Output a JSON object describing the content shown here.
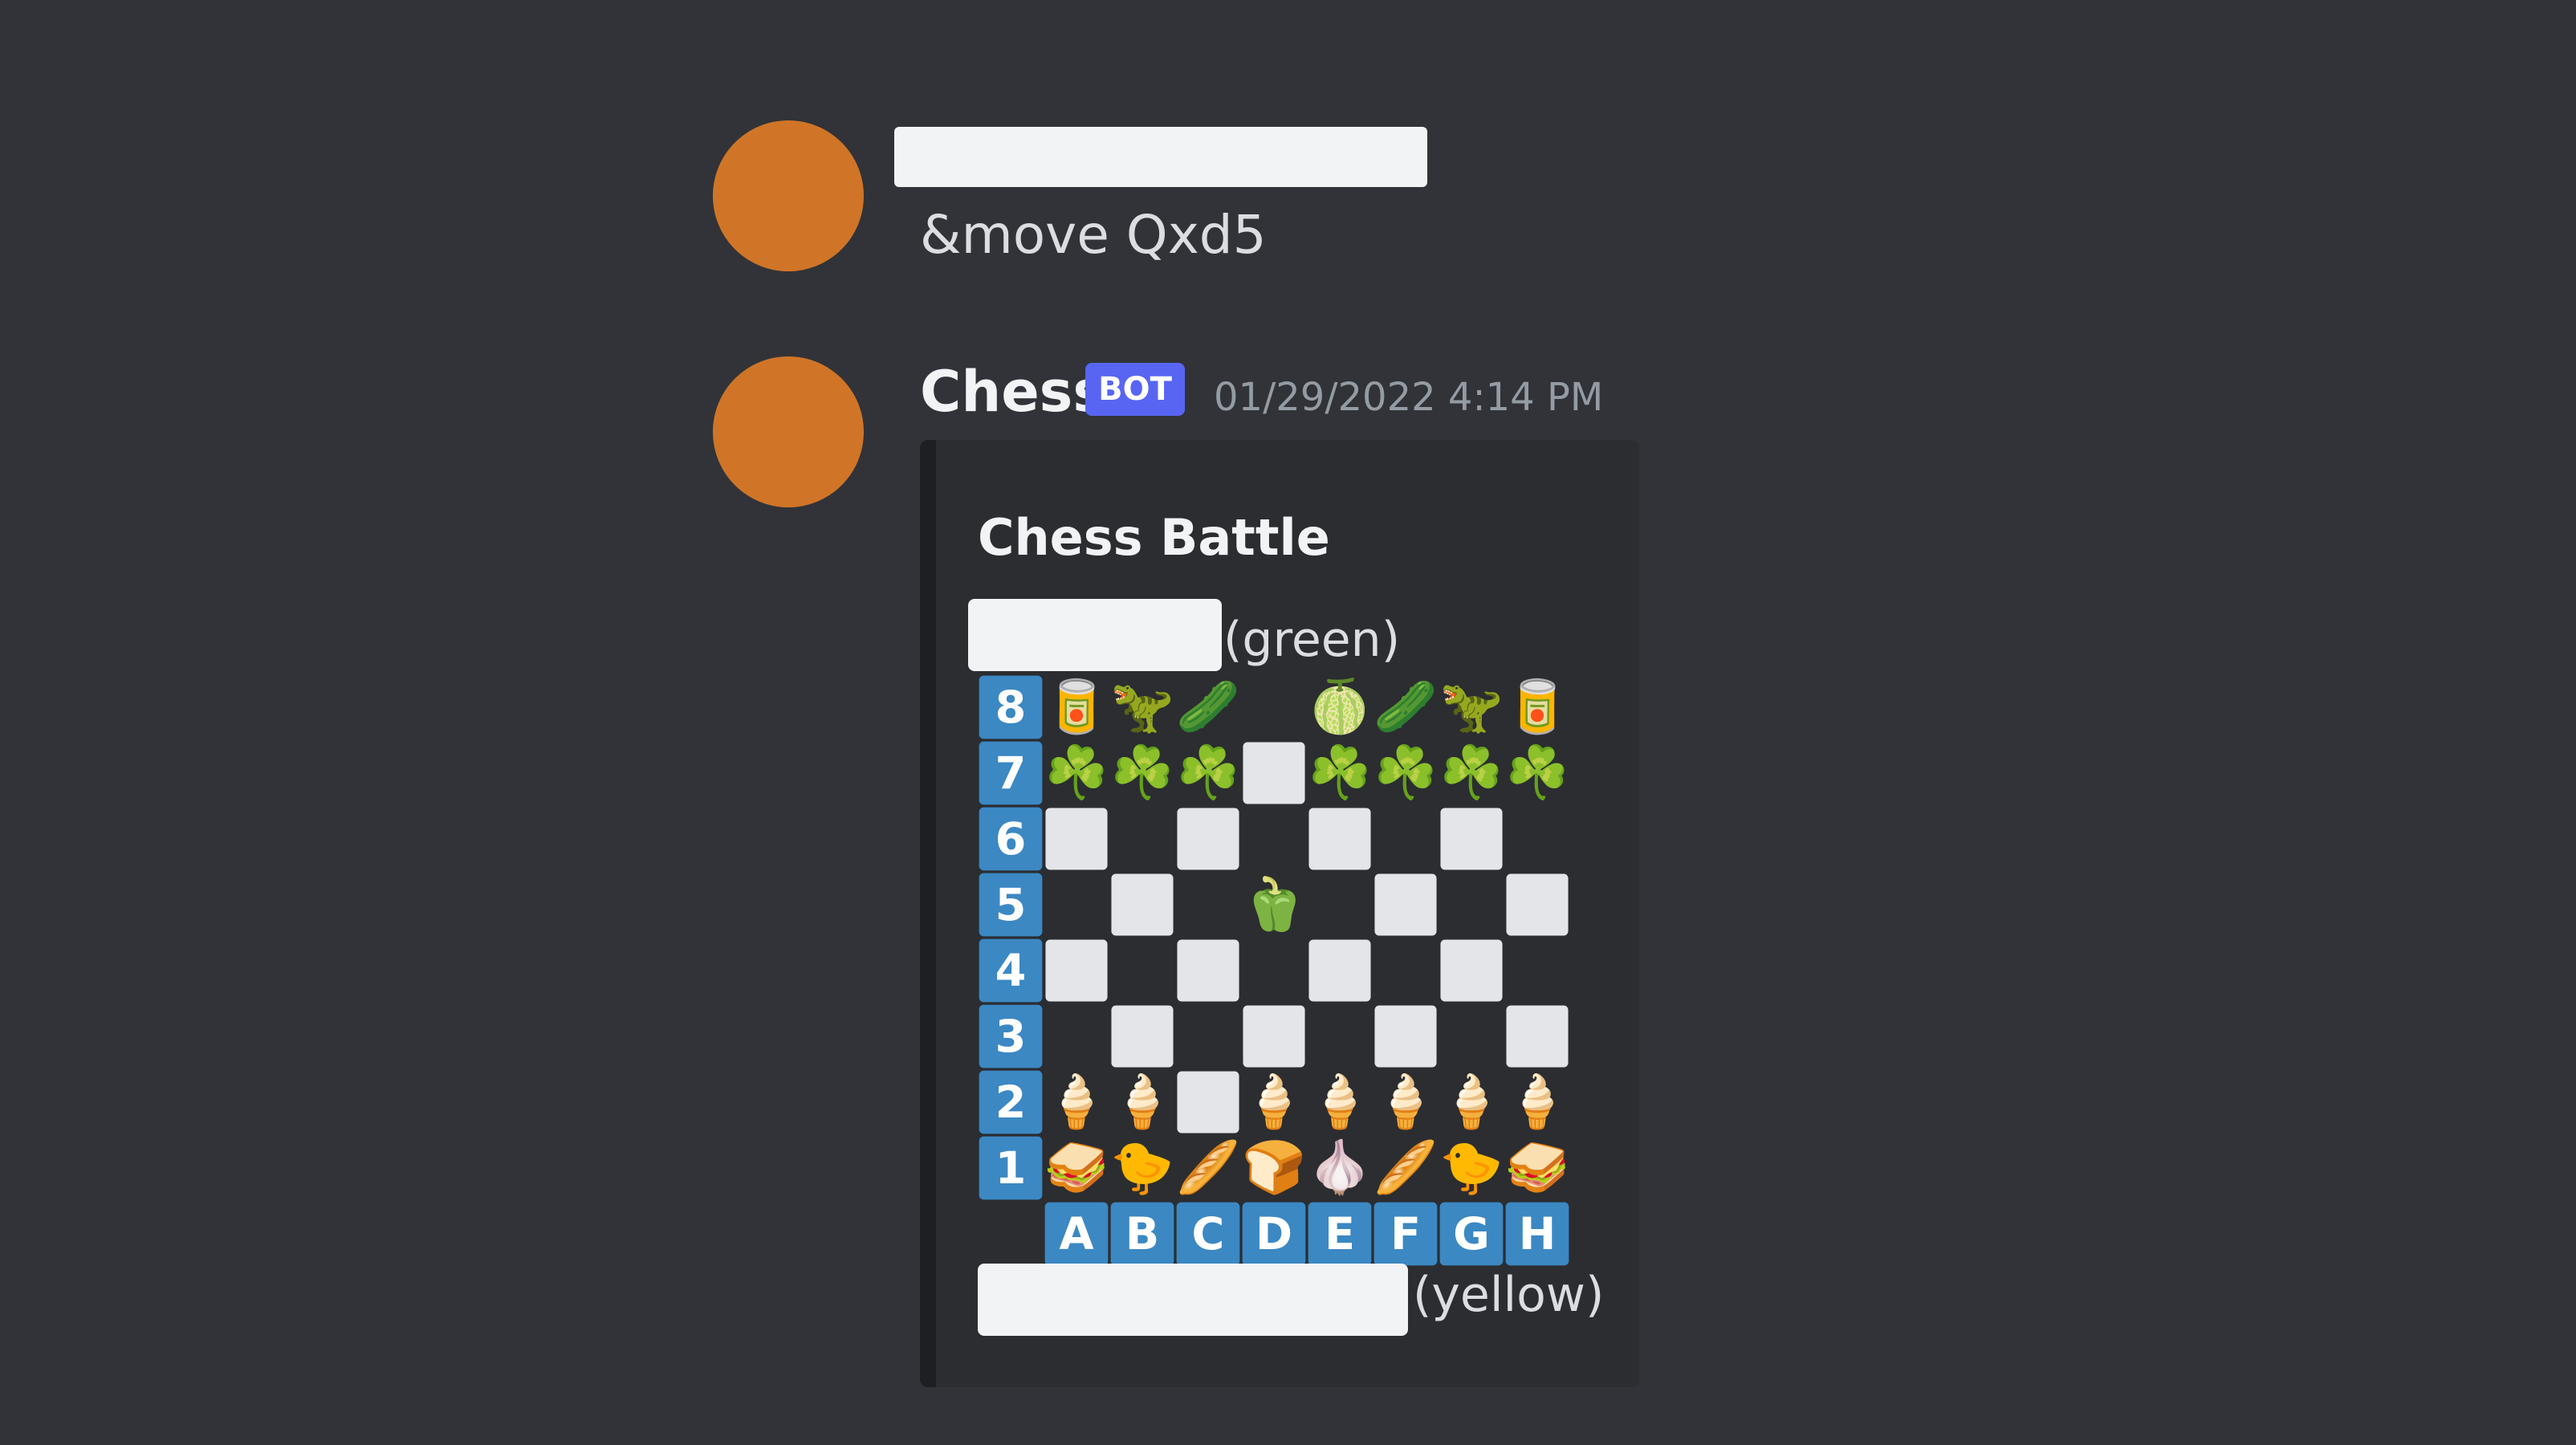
{
  "messages": [
    {
      "author_redacted": true,
      "text": "&move Qxd5"
    },
    {
      "author": "Chess",
      "badge": "BOT",
      "timestamp": "01/29/2022 4:14 PM",
      "embed": {
        "title": "Chess Battle",
        "top_player_label": "(green)",
        "bottom_player_label": "(yellow)",
        "ranks": [
          "8",
          "7",
          "6",
          "5",
          "4",
          "3",
          "2",
          "1"
        ],
        "files": [
          "A",
          "B",
          "C",
          "D",
          "E",
          "F",
          "G",
          "H"
        ],
        "board": [
          [
            "🥫",
            "🦖",
            "🥒",
            "",
            "🍈",
            "🥒",
            "🦖",
            "🥫"
          ],
          [
            "☘️",
            "☘️",
            "☘️",
            "",
            "☘️",
            "☘️",
            "☘️",
            "☘️"
          ],
          [
            "",
            "",
            "",
            "",
            "",
            "",
            "",
            ""
          ],
          [
            "",
            "",
            "",
            "🫑",
            "",
            "",
            "",
            ""
          ],
          [
            "",
            "",
            "",
            "",
            "",
            "",
            "",
            ""
          ],
          [
            "",
            "",
            "",
            "",
            "",
            "",
            "",
            ""
          ],
          [
            "🍦",
            "🍦",
            "",
            "🍦",
            "🍦",
            "🍦",
            "🍦",
            "🍦"
          ],
          [
            "🥪",
            "🐤",
            "🥖",
            "🍞",
            "🧄",
            "🥖",
            "🐤",
            "🥪"
          ]
        ]
      }
    }
  ],
  "colors": {
    "background": "#313338",
    "avatar": "#d07527",
    "badge": "#5865f2",
    "label_blue": "#3b88c3",
    "light_square": "#e3e5e8",
    "dark_square": "#2b2d31"
  }
}
